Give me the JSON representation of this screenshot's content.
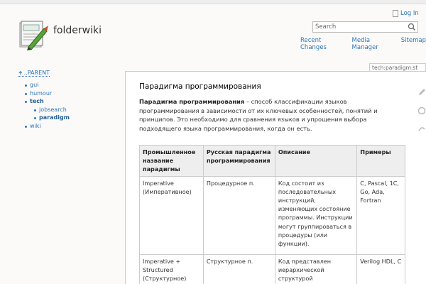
{
  "header": {
    "site_title": "folderwiki",
    "login_label": "Log In",
    "search_placeholder": "Search",
    "tools": [
      "Recent Changes",
      "Media Manager",
      "Sitemap"
    ]
  },
  "sidebar": {
    "parent_label": "..PARENT",
    "items": [
      {
        "label": "gui",
        "level": 1
      },
      {
        "label": "humour",
        "level": 1
      },
      {
        "label": "tech",
        "level": 1
      },
      {
        "label": "jobsearch",
        "level": 2
      },
      {
        "label": "paradigm",
        "level": 2
      },
      {
        "label": "wiki",
        "level": 1
      }
    ]
  },
  "page": {
    "page_id": "tech:paradigm:st",
    "title": "Парадигма программирования",
    "intro_bold": "Парадигма программирования",
    "intro_rest": " – способ классификации языков программирования в зависимости от их ключевых особенностей, понятий и принципов. Это необходимо для сравнения языков и упрощения выбора подходящего языка программирования, когда он есть.",
    "table": {
      "headers": [
        "Промышленное название парадигмы",
        "Русская парадигма программирования",
        "Описание",
        "Примеры"
      ],
      "rows": [
        [
          "Imperative (Императивное)",
          "Процедурное п.",
          "Код состоит из последовательных инструкций, изменяющих состояние программы. Инструкции могут группироваться в процедуры (или функции).",
          "C, Pascal, 1C, Go, Ada, Fortran"
        ],
        [
          "Imperative + Structured (Структурное)",
          "Структурное п.",
          "Код представлен иерархической структурой",
          "Verilog HDL, C"
        ]
      ]
    }
  },
  "colors": {
    "link": "#2b73b7",
    "header_bg": "#eeeeee",
    "page_bg": "#fbfaf9"
  }
}
